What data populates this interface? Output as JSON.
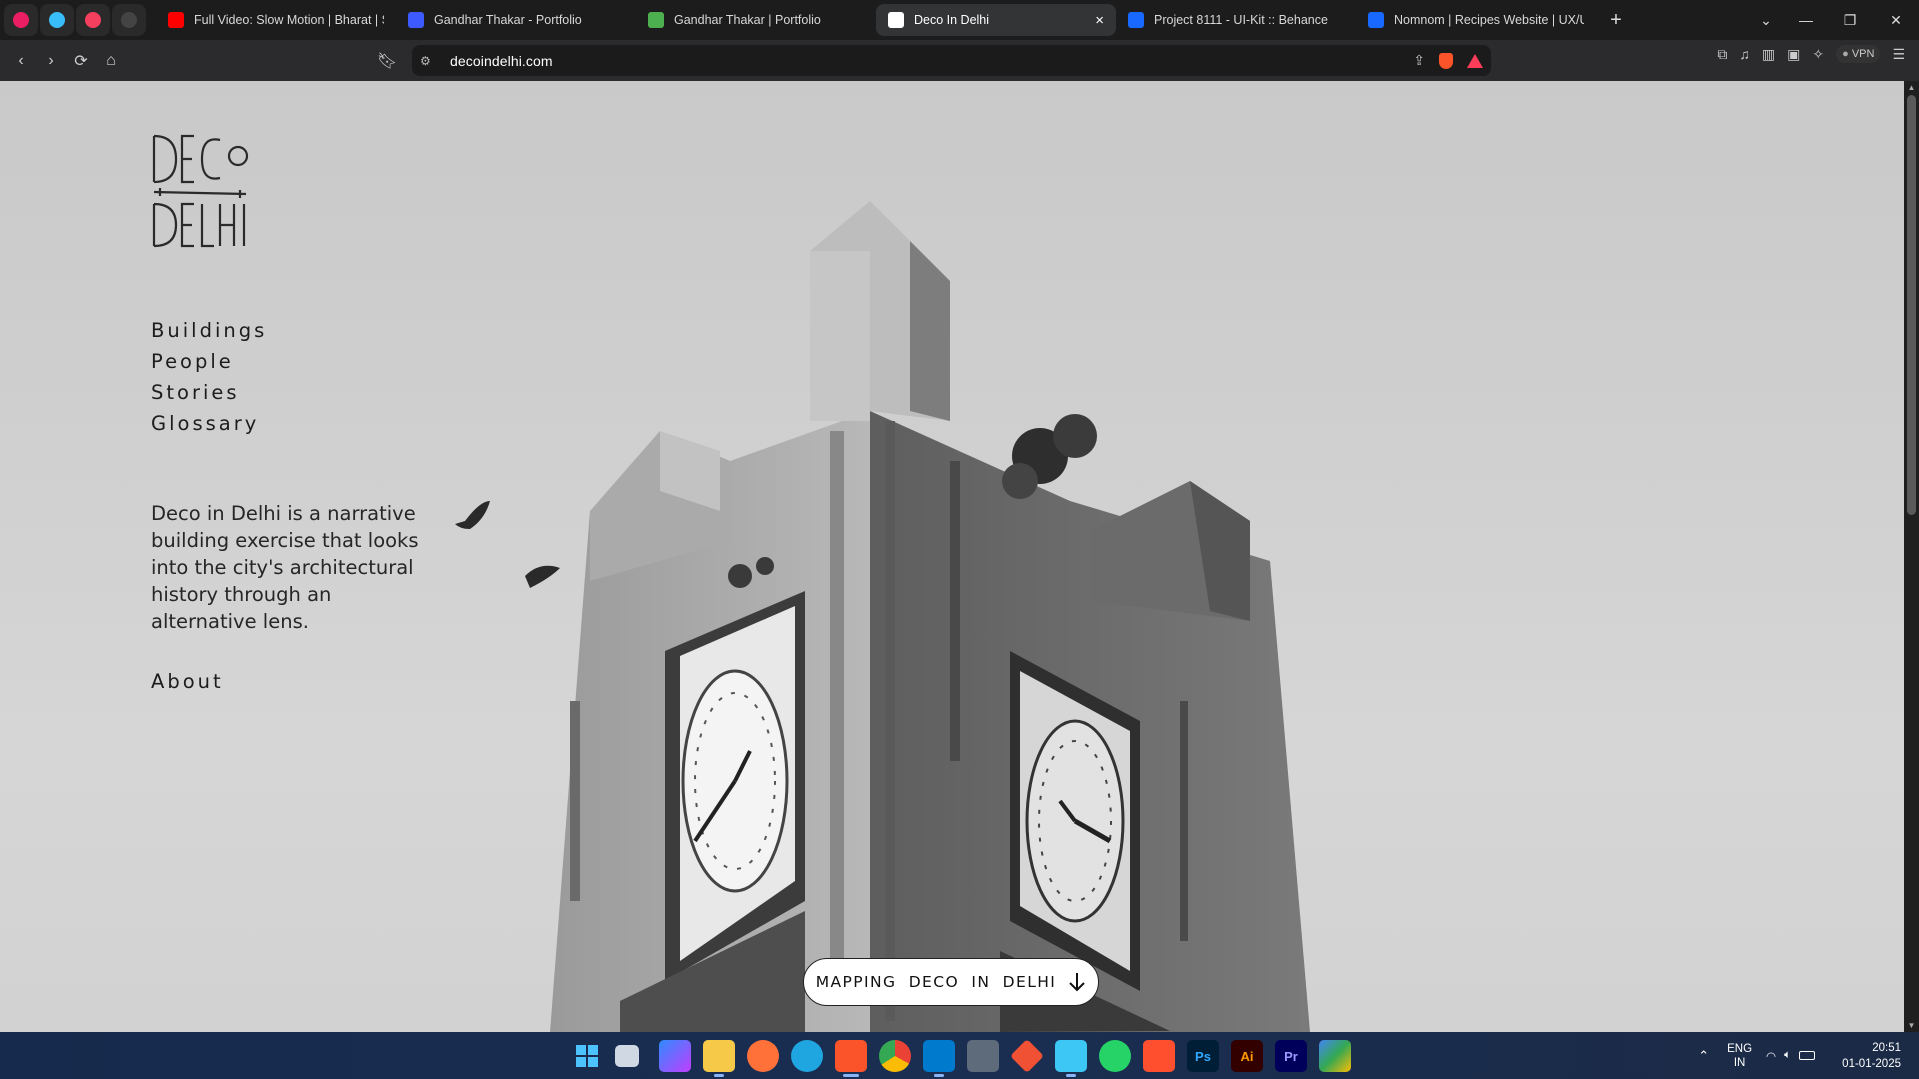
{
  "browser": {
    "tabs": [
      {
        "title": "Full Video: Slow Motion | Bharat | Sa",
        "favicon": "youtube-icon",
        "color": "#ff0000",
        "active": false
      },
      {
        "title": "Gandhar Thakar - Portfolio",
        "favicon": "gt-icon",
        "color": "#3d5afe",
        "active": false
      },
      {
        "title": "Gandhar Thakar | Portfolio",
        "favicon": "gt-green-icon",
        "color": "#4caf50",
        "active": false
      },
      {
        "title": "Deco In Delhi",
        "favicon": "page-icon",
        "color": "#ffffff",
        "active": true
      },
      {
        "title": "Project 8111 - UI-Kit :: Behance",
        "favicon": "behance-icon",
        "color": "#1769ff",
        "active": false
      },
      {
        "title": "Nomnom | Recipes Website | UX/UI",
        "favicon": "behance-icon",
        "color": "#1769ff",
        "active": false
      }
    ],
    "url": "decoindelhi.com",
    "vpn_label": "VPN"
  },
  "site": {
    "logo_text": "DECO IN DELHI",
    "nav": [
      "Buildings",
      "People",
      "Stories",
      "Glossary"
    ],
    "intro": "Deco in Delhi is a narrative building exercise that looks into the city's architectural history through an alternative lens.",
    "about": "About",
    "cta": "MAPPING DECO IN DELHI"
  },
  "taskbar": {
    "lang_top": "ENG",
    "lang_bottom": "IN",
    "time": "20:51",
    "date": "01-01-2025"
  }
}
